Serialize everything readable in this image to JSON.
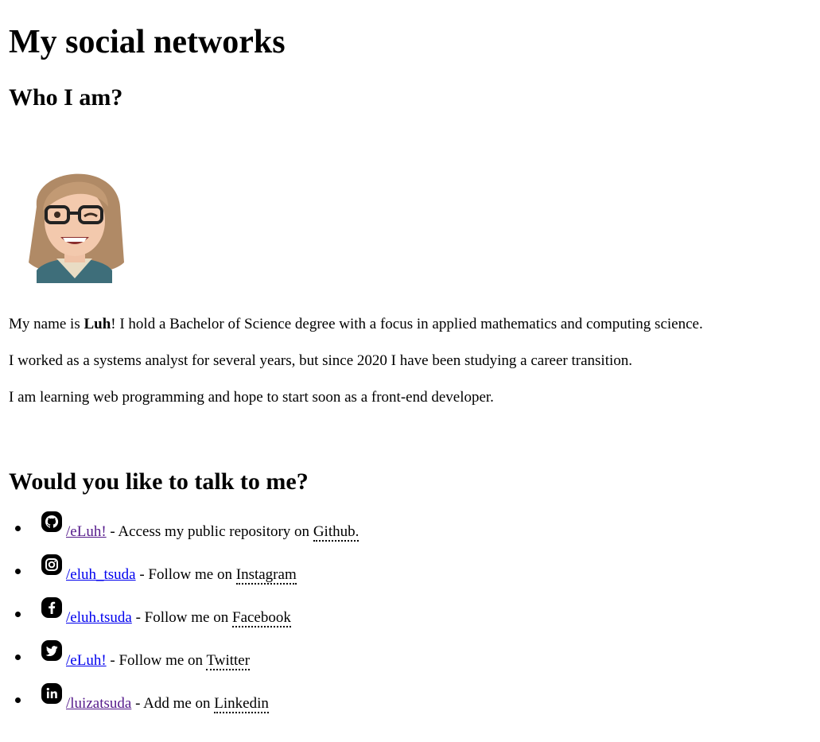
{
  "title": "My social networks",
  "section_about": {
    "heading": "Who I am?",
    "bio": {
      "p1_before": "My name is ",
      "p1_name": "Luh",
      "p1_after": "! I hold a Bachelor of Science degree with a focus in applied mathematics and computing science.",
      "p2": "I worked as a systems analyst for several years, but since 2020 I have been studying a career transition.",
      "p3": "I am learning web programming and hope to start soon as a front-end developer."
    }
  },
  "section_contact": {
    "heading": "Would you like to talk to me?",
    "items": [
      {
        "icon": "github-icon",
        "handle": "/eLuh!",
        "text": " - Access my public repository on ",
        "network": "Github.",
        "visited": true
      },
      {
        "icon": "instagram-icon",
        "handle": "/eluh_tsuda",
        "text": " - Follow me on ",
        "network": "Instagram",
        "visited": false
      },
      {
        "icon": "facebook-icon",
        "handle": "/eluh.tsuda",
        "text": " - Follow me on ",
        "network": "Facebook",
        "visited": false
      },
      {
        "icon": "twitter-icon",
        "handle": "/eLuh!",
        "text": " - Follow me on ",
        "network": "Twitter",
        "visited": false
      },
      {
        "icon": "linkedin-icon",
        "handle": "/luizatsuda",
        "text": " - Add me on ",
        "network": "Linkedin",
        "visited": true
      }
    ]
  },
  "colors": {
    "link": "#0000ee",
    "visited_link": "#551a8b"
  }
}
